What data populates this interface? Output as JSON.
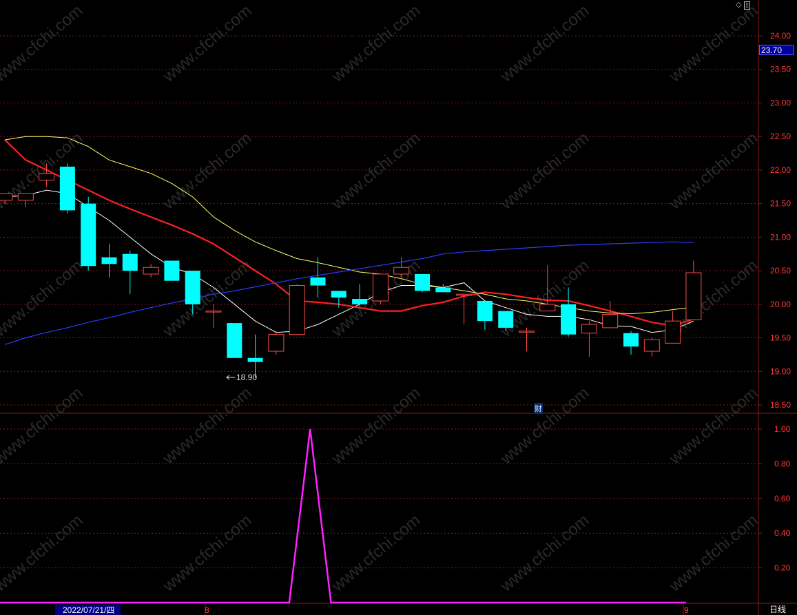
{
  "toolbar": {
    "icons": [
      "diamond-icon",
      "panel-icon"
    ]
  },
  "price_badge": "23.70",
  "fin_marker": "财",
  "low_annotation": "18.90",
  "period_label": "日线",
  "date_axis": {
    "current_date": "2022/07/21/四",
    "month_marks": [
      "8",
      "9"
    ]
  },
  "colors": {
    "up": "#ff4b4b",
    "down": "#00ffff",
    "grid": "#8b1a1a",
    "ma5": "#ffffff",
    "ma10": "#ff2020",
    "ma20": "#ffff66",
    "ma60": "#2a3cff",
    "indicator": "#ff20ff"
  },
  "chart_data": [
    {
      "type": "candlestick",
      "ylim": [
        18.4,
        24.3
      ],
      "y_ticks": [
        "24.00",
        "23.50",
        "23.00",
        "22.50",
        "22.00",
        "21.50",
        "21.00",
        "20.50",
        "20.00",
        "19.50",
        "19.00",
        "18.50"
      ],
      "candles": [
        {
          "o": 21.55,
          "h": 21.65,
          "l": 21.5,
          "c": 21.65
        },
        {
          "o": 21.55,
          "h": 21.65,
          "l": 21.45,
          "c": 21.65
        },
        {
          "o": 21.85,
          "h": 22.1,
          "l": 21.75,
          "c": 21.95
        },
        {
          "o": 22.05,
          "h": 22.1,
          "l": 21.35,
          "c": 21.4
        },
        {
          "o": 21.5,
          "h": 21.6,
          "l": 20.5,
          "c": 20.57
        },
        {
          "o": 20.7,
          "h": 20.9,
          "l": 20.4,
          "c": 20.6
        },
        {
          "o": 20.75,
          "h": 20.8,
          "l": 20.15,
          "c": 20.5
        },
        {
          "o": 20.45,
          "h": 20.6,
          "l": 20.4,
          "c": 20.55
        },
        {
          "o": 20.65,
          "h": 20.65,
          "l": 20.35,
          "c": 20.35
        },
        {
          "o": 20.5,
          "h": 20.5,
          "l": 19.85,
          "c": 20.0
        },
        {
          "o": 19.9,
          "h": 20.0,
          "l": 19.65,
          "c": 19.9
        },
        {
          "o": 19.72,
          "h": 19.72,
          "l": 19.2,
          "c": 19.2
        },
        {
          "o": 19.2,
          "h": 19.55,
          "l": 18.9,
          "c": 19.14
        },
        {
          "o": 19.3,
          "h": 19.6,
          "l": 19.25,
          "c": 19.55
        },
        {
          "o": 19.55,
          "h": 20.3,
          "l": 19.55,
          "c": 20.28
        },
        {
          "o": 20.4,
          "h": 20.7,
          "l": 20.1,
          "c": 20.28
        },
        {
          "o": 20.2,
          "h": 20.2,
          "l": 19.95,
          "c": 20.1
        },
        {
          "o": 20.08,
          "h": 20.3,
          "l": 19.97,
          "c": 20.0
        },
        {
          "o": 20.05,
          "h": 20.45,
          "l": 20.0,
          "c": 20.45
        },
        {
          "o": 20.45,
          "h": 20.7,
          "l": 20.4,
          "c": 20.55
        },
        {
          "o": 20.45,
          "h": 20.45,
          "l": 20.18,
          "c": 20.2
        },
        {
          "o": 20.25,
          "h": 20.3,
          "l": 20.18,
          "c": 20.18
        },
        {
          "o": 20.15,
          "h": 20.15,
          "l": 19.7,
          "c": 20.15
        },
        {
          "o": 20.05,
          "h": 20.05,
          "l": 19.62,
          "c": 19.75
        },
        {
          "o": 19.9,
          "h": 19.9,
          "l": 19.6,
          "c": 19.65
        },
        {
          "o": 19.6,
          "h": 19.65,
          "l": 19.3,
          "c": 19.6
        },
        {
          "o": 19.9,
          "h": 20.58,
          "l": 19.9,
          "c": 20.0
        },
        {
          "o": 20.0,
          "h": 20.25,
          "l": 19.52,
          "c": 19.55
        },
        {
          "o": 19.57,
          "h": 19.75,
          "l": 19.22,
          "c": 19.7
        },
        {
          "o": 19.65,
          "h": 20.05,
          "l": 19.65,
          "c": 19.85
        },
        {
          "o": 19.57,
          "h": 19.6,
          "l": 19.25,
          "c": 19.37
        },
        {
          "o": 19.3,
          "h": 19.5,
          "l": 19.22,
          "c": 19.47
        },
        {
          "o": 19.42,
          "h": 19.9,
          "l": 19.42,
          "c": 19.75
        },
        {
          "o": 19.77,
          "h": 20.65,
          "l": 19.77,
          "c": 20.47
        }
      ],
      "ma_lines": [
        {
          "name": "MA5",
          "values": [
            21.6,
            21.62,
            21.7,
            21.65,
            21.45,
            21.25,
            21.0,
            20.75,
            20.55,
            20.45,
            20.25,
            20.0,
            19.75,
            19.58,
            19.6,
            19.7,
            19.85,
            20.0,
            20.18,
            20.28,
            20.28,
            20.25,
            20.32,
            20.05,
            19.95,
            19.85,
            19.82,
            19.82,
            19.77,
            19.68,
            19.67,
            19.58,
            19.62,
            19.75
          ]
        },
        {
          "name": "MA10",
          "values": [
            22.45,
            22.15,
            22.0,
            21.85,
            21.7,
            21.55,
            21.42,
            21.3,
            21.18,
            21.05,
            20.9,
            20.7,
            20.5,
            20.3,
            20.05,
            20.03,
            20.0,
            19.95,
            19.9,
            19.9,
            19.98,
            20.03,
            20.12,
            20.18,
            20.15,
            20.1,
            20.06,
            20.05,
            19.98,
            19.9,
            19.82,
            19.73,
            19.68,
            19.78
          ]
        },
        {
          "name": "MA20",
          "values": [
            22.45,
            22.5,
            22.5,
            22.48,
            22.35,
            22.15,
            22.05,
            21.95,
            21.8,
            21.6,
            21.3,
            21.1,
            20.93,
            20.8,
            20.68,
            20.62,
            20.55,
            20.48,
            20.45,
            20.38,
            20.3,
            20.25,
            20.2,
            20.15,
            20.08,
            20.05,
            20.0,
            19.95,
            19.9,
            19.87,
            19.86,
            19.88,
            19.92,
            19.96
          ]
        },
        {
          "name": "MA60",
          "values": [
            19.4,
            19.5,
            19.58,
            19.65,
            19.73,
            19.8,
            19.88,
            19.95,
            20.02,
            20.08,
            20.15,
            20.2,
            20.26,
            20.32,
            20.38,
            20.43,
            20.48,
            20.53,
            20.58,
            20.63,
            20.68,
            20.75,
            20.78,
            20.8,
            20.82,
            20.84,
            20.86,
            20.88,
            20.89,
            20.9,
            20.91,
            20.92,
            20.93,
            20.92
          ]
        }
      ]
    },
    {
      "type": "line",
      "ylim": [
        0,
        1.05
      ],
      "y_ticks": [
        "1.00",
        "0.80",
        "0.60",
        "0.40",
        "0.20"
      ],
      "series": [
        {
          "values": [
            0,
            0,
            0,
            0,
            0,
            0,
            0,
            0,
            0,
            0,
            0,
            0,
            0,
            0,
            1,
            0,
            0,
            0,
            0,
            0,
            0,
            0,
            0,
            0,
            0,
            0,
            0,
            0,
            0,
            0,
            0,
            0,
            0
          ]
        }
      ]
    }
  ]
}
